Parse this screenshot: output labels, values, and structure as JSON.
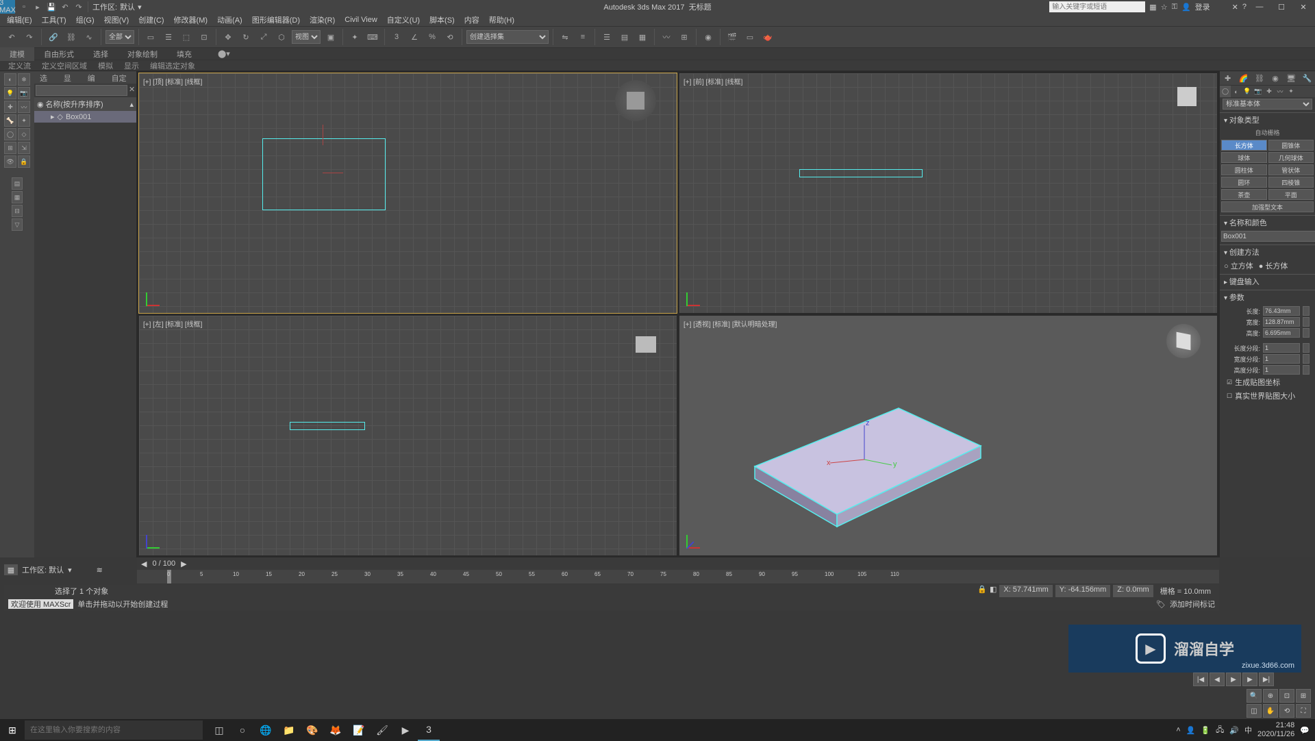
{
  "app": {
    "title": "Autodesk 3ds Max 2017",
    "doc": "无标题",
    "logo": "3 MAX"
  },
  "workspace": {
    "label": "工作区:",
    "value": "默认"
  },
  "search": {
    "placeholder": "输入关键字或短语"
  },
  "login": "登录",
  "menus": [
    "编辑(E)",
    "工具(T)",
    "组(G)",
    "视图(V)",
    "创建(C)",
    "修改器(M)",
    "动画(A)",
    "图形编辑器(D)",
    "渲染(R)",
    "Civil View",
    "自定义(U)",
    "脚本(S)",
    "内容",
    "帮助(H)"
  ],
  "toolbar": {
    "selset": "创建选择集",
    "filter": "全部",
    "view": "视图"
  },
  "ribbon": {
    "tabs": [
      "建模",
      "自由形式",
      "选择",
      "对象绘制",
      "填充"
    ]
  },
  "subribbon": [
    "定义流",
    "定义空间区域",
    "模拟",
    "显示",
    "编辑选定对象"
  ],
  "explorer": {
    "tabs": [
      "选择",
      "显示",
      "编辑",
      "自定义"
    ],
    "header": "名称(按升序排序)",
    "item": "Box001"
  },
  "viewports": {
    "top": "[+] [顶] [标准] [线框]",
    "front": "[+] [前] [标准] [线框]",
    "left": "[+] [左] [标准] [线框]",
    "persp": "[+] [透视] [标准] [默认明暗处理]"
  },
  "cmd": {
    "category": "标准基本体",
    "rollouts": {
      "objtype": "对象类型",
      "autogrid": "自动栅格",
      "namecolor": "名称和颜色",
      "method": "创建方法",
      "keyboard": "键盘输入",
      "params": "参数"
    },
    "buttons": {
      "box": "长方体",
      "cone": "圆锥体",
      "sphere": "球体",
      "geosphere": "几何球体",
      "cyl": "圆柱体",
      "tube": "管状体",
      "torus": "圆环",
      "pyramid": "四棱锥",
      "teapot": "茶壶",
      "plane": "平面",
      "textplus": "加强型文本"
    },
    "name": "Box001",
    "method_opts": {
      "cube": "立方体",
      "box": "长方体"
    },
    "params": {
      "length_l": "长度:",
      "length_v": "76.43mm",
      "width_l": "宽度:",
      "width_v": "128.87mm",
      "height_l": "高度:",
      "height_v": "6.695mm",
      "lseg_l": "长度分段:",
      "lseg_v": "1",
      "wseg_l": "宽度分段:",
      "wseg_v": "1",
      "hseg_l": "高度分段:",
      "hseg_v": "1",
      "genmap": "生成贴图坐标",
      "realworld": "真实世界贴图大小"
    }
  },
  "timetrack": {
    "frame": "0 / 100"
  },
  "timeline": {
    "ticks": [
      "0",
      "5",
      "10",
      "15",
      "20",
      "25",
      "30",
      "35",
      "40",
      "45",
      "50",
      "55",
      "60",
      "65",
      "70",
      "75",
      "80",
      "85",
      "90",
      "95",
      "100",
      "105",
      "110"
    ]
  },
  "status": {
    "sel": "选择了 1 个对象",
    "hint": "单击并拖动以开始创建过程"
  },
  "coords": {
    "x": "X: 57.741mm",
    "y": "Y: -64.156mm",
    "z": "Z: 0.0mm",
    "grid": "栅格 = 10.0mm"
  },
  "status2": {
    "script": "欢迎使用 MAXScr",
    "addtime": "添加时间标记"
  },
  "taskbar": {
    "search": "在这里输入你要搜索的内容",
    "time": "21:48",
    "date": "2020/11/26"
  },
  "watermark": {
    "text": "溜溜自学",
    "url": "zixue.3d66.com"
  },
  "wslabel2": "工作区: 默认"
}
